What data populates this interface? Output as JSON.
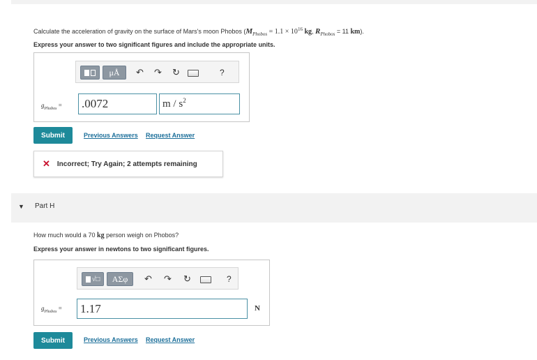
{
  "partG": {
    "question_prefix": "Calculate the acceleration of gravity on the surface of Mars's moon Phobos (",
    "mass_sym": "M",
    "mass_sub": "Phobos",
    "mass_val": " = 1.1 × 10",
    "mass_exp": "16",
    "mass_unit": " kg",
    "radius_sym": "R",
    "radius_sub": "Phobos",
    "radius_eq": " = 11 ",
    "radius_unit": "km",
    "question_suffix": ").",
    "instruction": "Express your answer to two significant figures and include the appropriate units.",
    "toolbar": {
      "templates_label": "μÅ",
      "help_label": "?"
    },
    "var_sym": "g",
    "var_sub": "Phobos",
    "equals": " =",
    "value": ".0072",
    "unit_base": "m / s",
    "unit_exp": "2",
    "submit_label": "Submit",
    "previous_answers": "Previous Answers",
    "request_answer": "Request Answer",
    "feedback_text": "Incorrect; Try Again; 2 attempts remaining"
  },
  "partH": {
    "title": "Part H",
    "question_prefix": "How much would a 70 ",
    "question_unit": "kg",
    "question_suffix": " person weigh on Phobos?",
    "instruction": "Express your answer in newtons to two significant figures.",
    "toolbar": {
      "templates_label": "ΑΣφ",
      "help_label": "?"
    },
    "var_sym": "g",
    "var_sub": "Phobos",
    "equals": " =",
    "value": "1.17",
    "unit": "N",
    "submit_label": "Submit",
    "previous_answers": "Previous Answers",
    "request_answer": "Request Answer"
  },
  "colors": {
    "submit": "#1e8a9a",
    "link": "#1c6f9a",
    "error": "#c8102e"
  }
}
